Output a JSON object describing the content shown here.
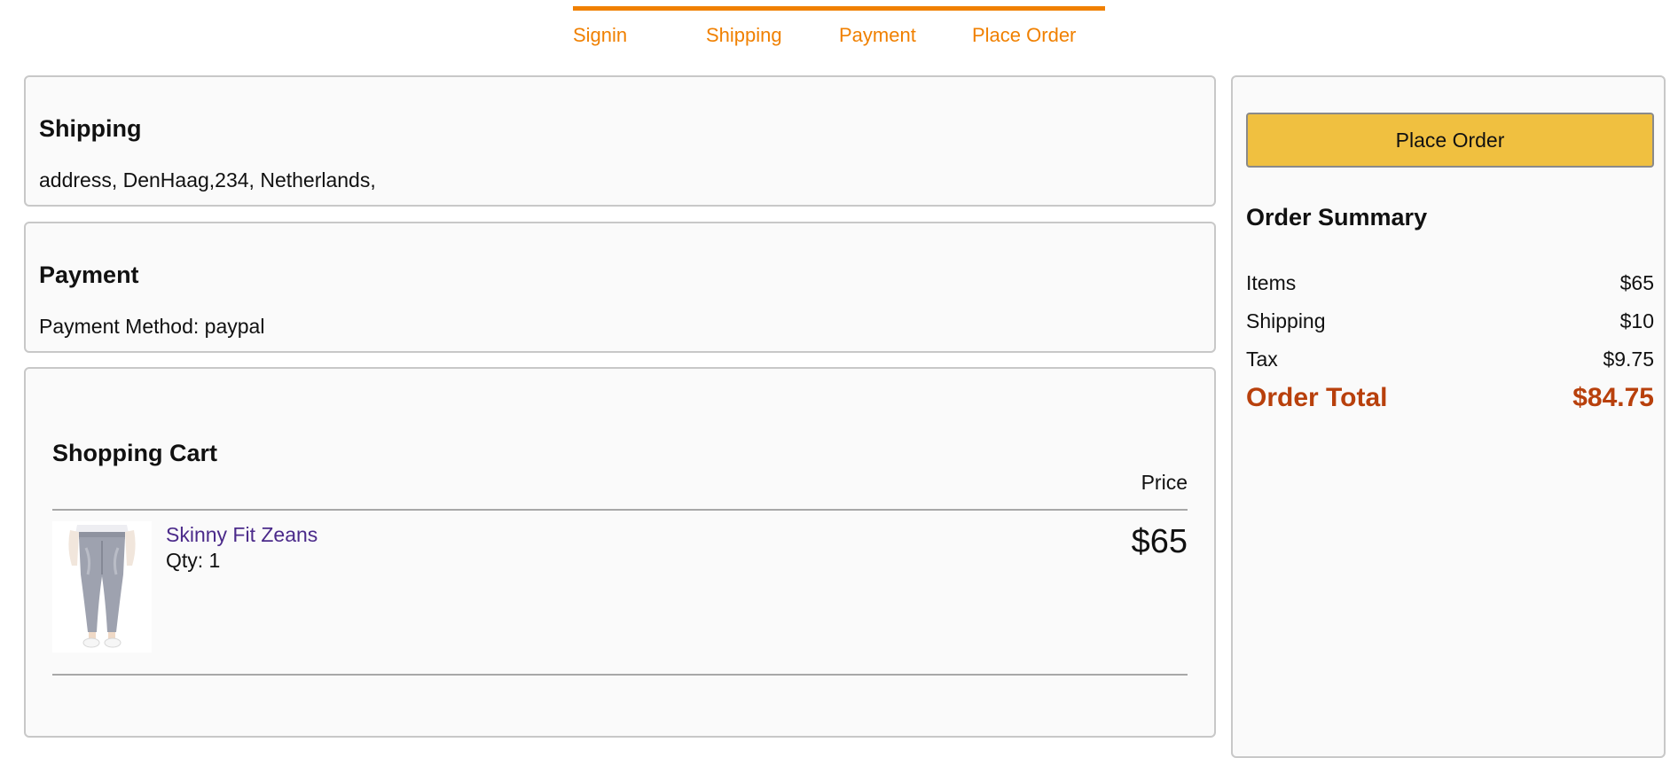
{
  "steps": [
    {
      "label": "Signin"
    },
    {
      "label": "Shipping"
    },
    {
      "label": "Payment"
    },
    {
      "label": "Place Order"
    }
  ],
  "colors": {
    "accent": "#f08000",
    "button": "#f0c040",
    "total": "#b8400c",
    "link": "#4b2a8a"
  },
  "shipping": {
    "title": "Shipping",
    "address": "address, DenHaag,234, Netherlands,"
  },
  "payment": {
    "title": "Payment",
    "method": "Payment Method: paypal"
  },
  "cart": {
    "title": "Shopping Cart",
    "price_header": "Price",
    "items": [
      {
        "name": "Skinny Fit Zeans",
        "qty": "Qty: 1",
        "price": "$65",
        "image_icon": "jeans-product-image"
      }
    ]
  },
  "summary": {
    "button_label": "Place Order",
    "title": "Order Summary",
    "rows": [
      {
        "label": "Items",
        "value": "$65"
      },
      {
        "label": "Shipping",
        "value": "$10"
      },
      {
        "label": "Tax",
        "value": "$9.75"
      }
    ],
    "total": {
      "label": "Order Total",
      "value": "$84.75"
    }
  }
}
